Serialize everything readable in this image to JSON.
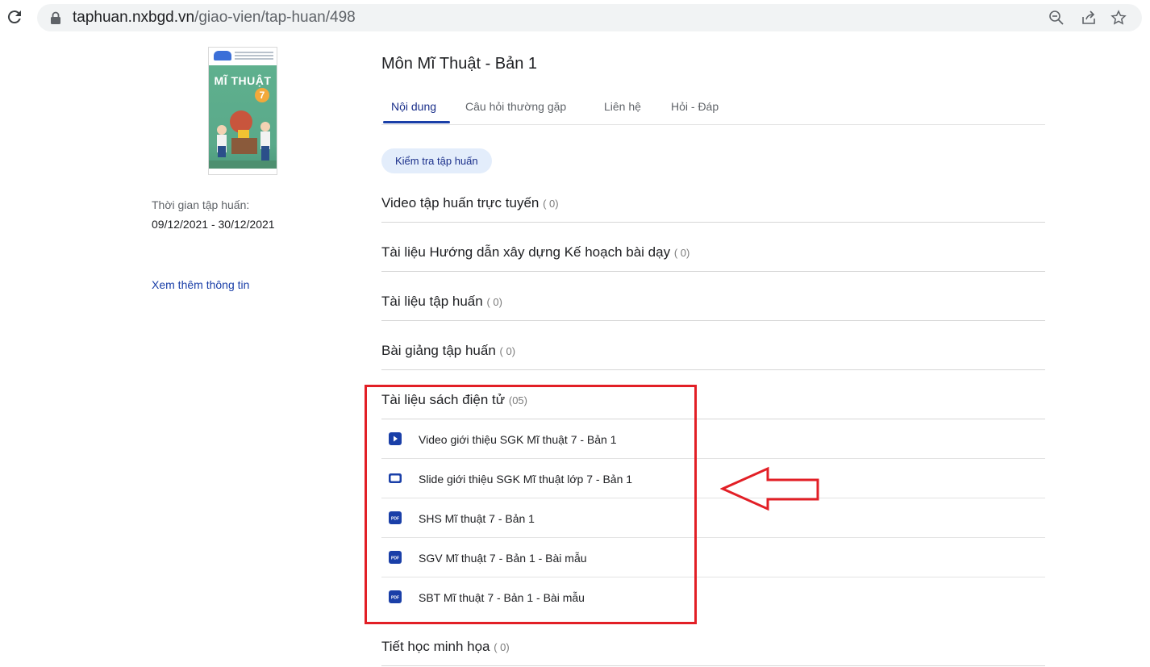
{
  "browser": {
    "url_host": "taphuan.nxbgd.vn",
    "url_path": "/giao-vien/tap-huan/498",
    "icons": [
      "reload-icon",
      "lock-icon",
      "zoom-out-icon",
      "share-icon",
      "bookmark-star-icon"
    ]
  },
  "book": {
    "cover_title": "MĨ THUẬT",
    "cover_number": "7"
  },
  "sidebar": {
    "time_label": "Thời gian tập huấn:",
    "time_value": "09/12/2021 - 30/12/2021",
    "more_info": "Xem thêm thông tin"
  },
  "main": {
    "title": "Môn Mĩ Thuật - Bản 1",
    "tabs": [
      {
        "label": "Nội dung",
        "active": true
      },
      {
        "label": "Câu hỏi thường gặp",
        "active": false
      },
      {
        "label": "Liên hệ",
        "active": false
      },
      {
        "label": "Hỏi - Đáp",
        "active": false
      }
    ],
    "exam_button": "Kiểm tra tập huấn",
    "sections": [
      {
        "title": "Video tập huấn trực tuyến",
        "count": "( 0)"
      },
      {
        "title": "Tài liệu Hướng dẫn xây dựng Kế hoạch bài dạy",
        "count": "( 0)"
      },
      {
        "title": "Tài liệu tập huấn",
        "count": "( 0)"
      },
      {
        "title": "Bài giảng tập huấn",
        "count": "( 0)"
      },
      {
        "title": "Tài liệu sách điện tử",
        "count": "(05)"
      },
      {
        "title": "Tiết học minh họa",
        "count": "( 0)"
      }
    ],
    "ebook_items": [
      {
        "label": "Video giới thiệu SGK Mĩ thuật 7 - Bản 1",
        "icon": "video-play-icon"
      },
      {
        "label": "Slide giới thiệu SGK Mĩ thuật lớp 7 - Bản 1",
        "icon": "slide-icon"
      },
      {
        "label": "SHS Mĩ thuật 7 - Bản 1",
        "icon": "pdf-icon"
      },
      {
        "label": "SGV Mĩ thuật 7 - Bản 1 - Bài mẫu",
        "icon": "pdf-icon"
      },
      {
        "label": "SBT Mĩ thuật 7 - Bản 1 - Bài mẫu",
        "icon": "pdf-icon"
      }
    ]
  },
  "colors": {
    "accent": "#1a3fa8",
    "chip_bg": "#e3edfb",
    "annotation_red": "#e21f26"
  }
}
